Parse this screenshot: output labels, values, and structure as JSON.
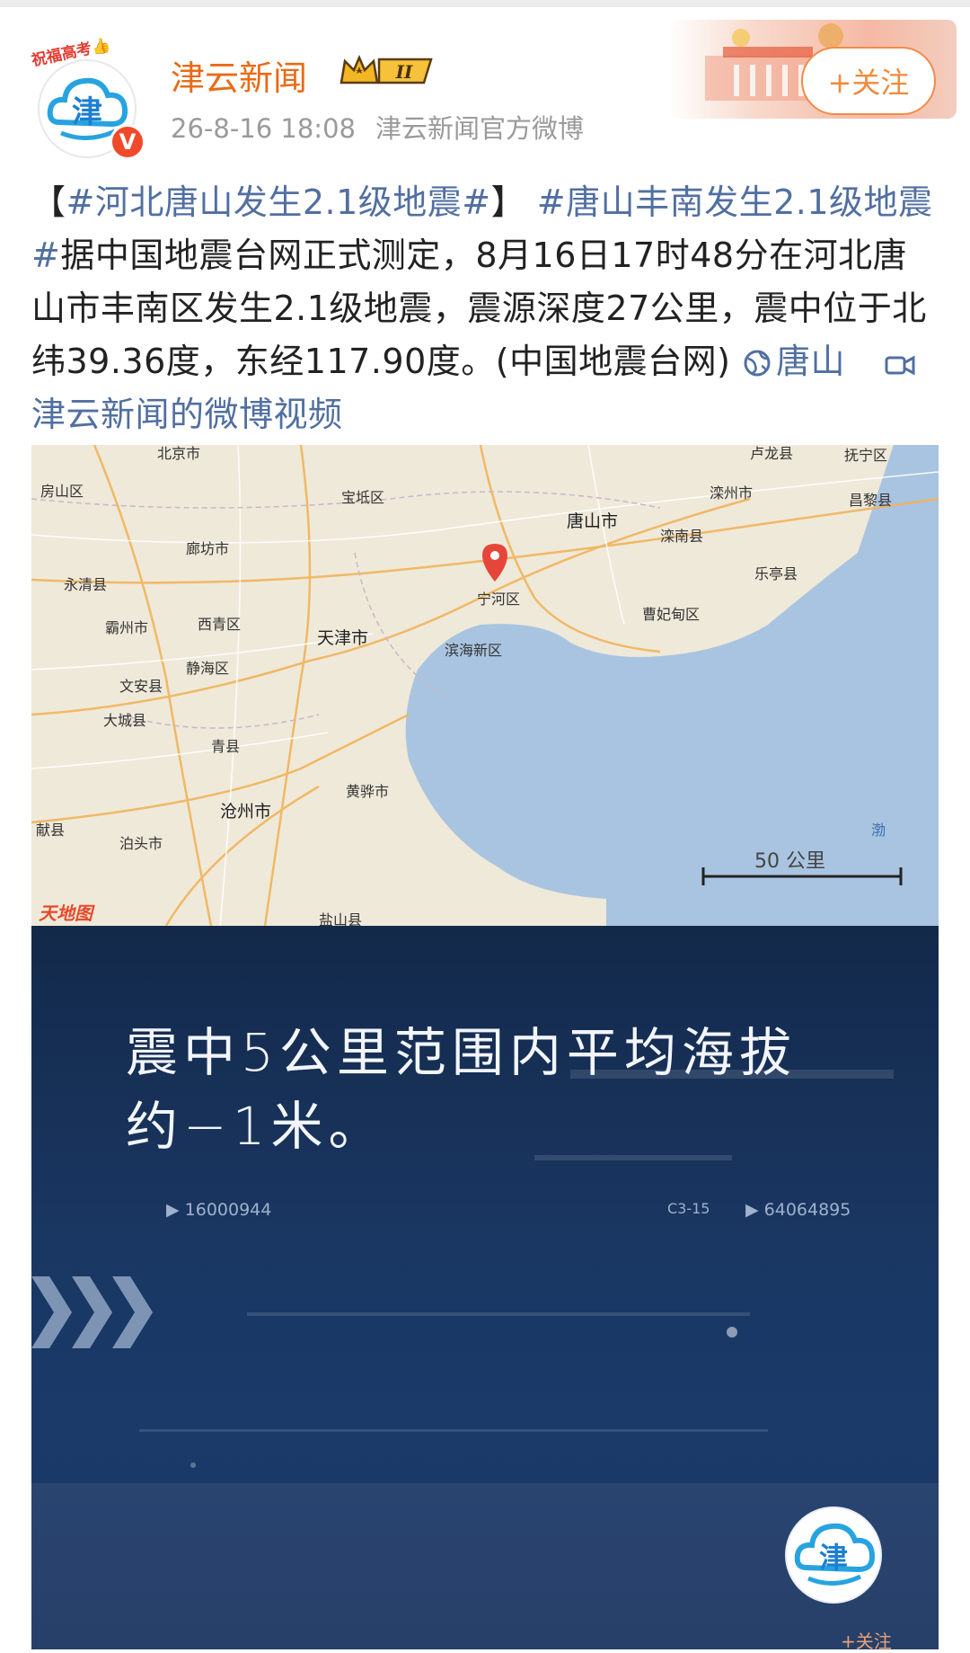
{
  "account": {
    "name": "津云新闻",
    "badge_text": "祝福高考👍",
    "verified_mark": "V",
    "level_label": "II",
    "timestamp": "26-8-16 18:08",
    "source": "津云新闻官方微博",
    "follow_label": "+关注"
  },
  "post": {
    "topic1": "#河北唐山发生2.1级地震#",
    "bracket_open": "【",
    "bracket_close": "】",
    "topic2": "#唐山丰南发生2.1级地震#",
    "body": "据中国地震台网正式测定，8月16日17时48分在河北唐山市丰南区发生2.1级地震，震源深度27公里，震中位于北纬39.36度，东经117.90度。(中国地震台网)",
    "location_label": "唐山",
    "video_label": "津云新闻的微博视频"
  },
  "map": {
    "cities": [
      {
        "name": "北京市"
      },
      {
        "name": "卢龙县"
      },
      {
        "name": "抚宁区"
      },
      {
        "name": "房山区"
      },
      {
        "name": "宝坻区"
      },
      {
        "name": "滦州市"
      },
      {
        "name": "昌黎县"
      },
      {
        "name": "唐山市"
      },
      {
        "name": "廊坊市"
      },
      {
        "name": "滦南县"
      },
      {
        "name": "永清县"
      },
      {
        "name": "宁河区"
      },
      {
        "name": "乐亭县"
      },
      {
        "name": "曹妃甸区"
      },
      {
        "name": "霸州市"
      },
      {
        "name": "西青区"
      },
      {
        "name": "天津市"
      },
      {
        "name": "滨海新区"
      },
      {
        "name": "静海区"
      },
      {
        "name": "文安县"
      },
      {
        "name": "大城县"
      },
      {
        "name": "青县"
      },
      {
        "name": "黄骅市"
      },
      {
        "name": "沧州市"
      },
      {
        "name": "献县"
      },
      {
        "name": "泊头市"
      },
      {
        "name": "盐山县"
      },
      {
        "name": "渤"
      }
    ],
    "scale_label": "50 公里",
    "provider": "天地图"
  },
  "video": {
    "caption": "震中5公里范围内平均海拔约−1米。",
    "code_left": "▶ 16000944",
    "code_mid": "C3-15",
    "code_right": "▶  64064895",
    "float_follow": "+关注"
  },
  "colors": {
    "brand_orange": "#e96b15",
    "topic_blue": "#516fa1",
    "video_bg": "#1a3763"
  }
}
